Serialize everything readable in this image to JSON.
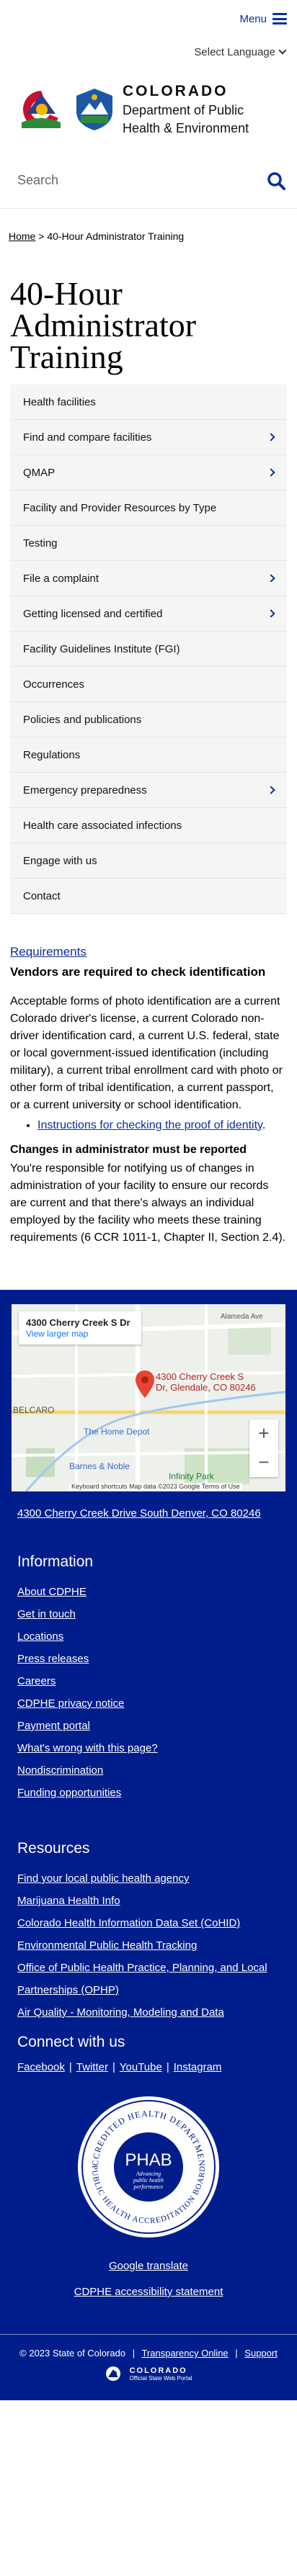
{
  "header": {
    "menu_label": "Menu",
    "language_label": "Select Language",
    "org_name": "COLORADO",
    "dept_line1": "Department of Public",
    "dept_line2": "Health & Environment",
    "search_placeholder": "Search"
  },
  "breadcrumb": {
    "home": "Home",
    "separator": ">",
    "current": "40-Hour Administrator Training"
  },
  "page_title": "40-Hour Administrator Training",
  "sidenav": [
    {
      "label": "Health facilities",
      "has_children": false
    },
    {
      "label": "Find and compare facilities",
      "has_children": true
    },
    {
      "label": "QMAP",
      "has_children": true
    },
    {
      "label": "Facility and Provider Resources by Type",
      "has_children": false
    },
    {
      "label": "Testing",
      "has_children": false
    },
    {
      "label": "File a complaint",
      "has_children": true
    },
    {
      "label": "Getting licensed and certified",
      "has_children": true
    },
    {
      "label": "Facility Guidelines Institute (FGI)",
      "has_children": false
    },
    {
      "label": "Occurrences",
      "has_children": false
    },
    {
      "label": "Policies and publications",
      "has_children": false
    },
    {
      "label": "Regulations",
      "has_children": false
    },
    {
      "label": "Emergency preparedness",
      "has_children": true
    },
    {
      "label": "Health care associated infections",
      "has_children": false
    },
    {
      "label": "Engage with us",
      "has_children": false
    },
    {
      "label": "Contact",
      "has_children": false
    }
  ],
  "content": {
    "requirements_link": "Requirements",
    "vendors_heading": "Vendors are required to check identification",
    "id_paragraph": "Acceptable forms of photo identification are a current Colorado driver's license, a current Colorado non-driver identification card, a current U.S. federal, state or local government-issued identification (including military), a current tribal enrollment card with photo or other form of tribal identification, a current passport, or a current university or school identification.",
    "id_link_text": "Instructions for checking the proof of identity",
    "id_link_suffix": ".",
    "changes_heading": "Changes in administrator must be reported",
    "changes_paragraph": "You're responsible for notifying us of changes in administration of your facility to ensure our records are current and that there's always an individual employed by the facility who meets these training requirements (6 CCR 1011-1, Chapter II, Section 2.4)."
  },
  "map": {
    "card_title": "4300 Cherry Creek S Dr",
    "card_link": "View larger map",
    "pin_label_line1": "4300 Cherry Creek S",
    "pin_label_line2": "Dr, Glendale, CO 80246",
    "place_homedepot": "The Home Depot",
    "place_belcaro": "BELCARO",
    "place_barnes": "Barnes & Noble",
    "place_infinity": "Infinity Park",
    "place_alameda": "Alameda Ave",
    "attribution": "Keyboard shortcuts   Map data ©2023 Google   Terms of Use",
    "zoom_in": "+",
    "zoom_out": "−"
  },
  "footer": {
    "address": "4300 Cherry Creek Drive South Denver, CO 80246",
    "info_heading": "Information",
    "info_links": [
      "About CDPHE",
      "Get in touch",
      "Locations",
      "Press releases",
      "Careers",
      "CDPHE privacy notice",
      "Payment portal",
      "What's wrong with this page?",
      "Nondiscrimination",
      "Funding opportunities"
    ],
    "resources_heading": "Resources",
    "resource_links": [
      "Find your local public health agency",
      "Marijuana Health Info",
      "Colorado Health Information Data Set (CoHID)",
      "Environmental Public Health Tracking",
      "Office of Public Health Practice, Planning, and Local Partnerships (OPHP)",
      "Air Quality - Monitoring, Modeling and Data"
    ],
    "connect_heading": "Connect with us",
    "social": [
      "Facebook",
      "Twitter",
      "YouTube",
      "Instagram"
    ],
    "social_separator": "|",
    "badge_text_top": "ACCREDITED HEALTH DEPARTMENT",
    "badge_text_bottom": "PUBLIC HEALTH ACCREDITATION BOARD",
    "badge_center": "PHAB",
    "badge_sub1": "Advancing",
    "badge_sub2": "public health",
    "badge_sub3": "performance",
    "google_translate": "Google translate",
    "accessibility": "CDPHE accessibility statement",
    "copyright": "© 2023 State of Colorado",
    "transparency": "Transparency Online",
    "support": "Support",
    "portal_name": "COLORADO",
    "portal_sub": "Official State Web Portal"
  },
  "colors": {
    "brand_blue": "#0b2f9c",
    "footer_blue": "#001e8b",
    "logo_red": "#c8102e",
    "logo_gold": "#f2b705",
    "logo_green": "#2e8b3c"
  }
}
